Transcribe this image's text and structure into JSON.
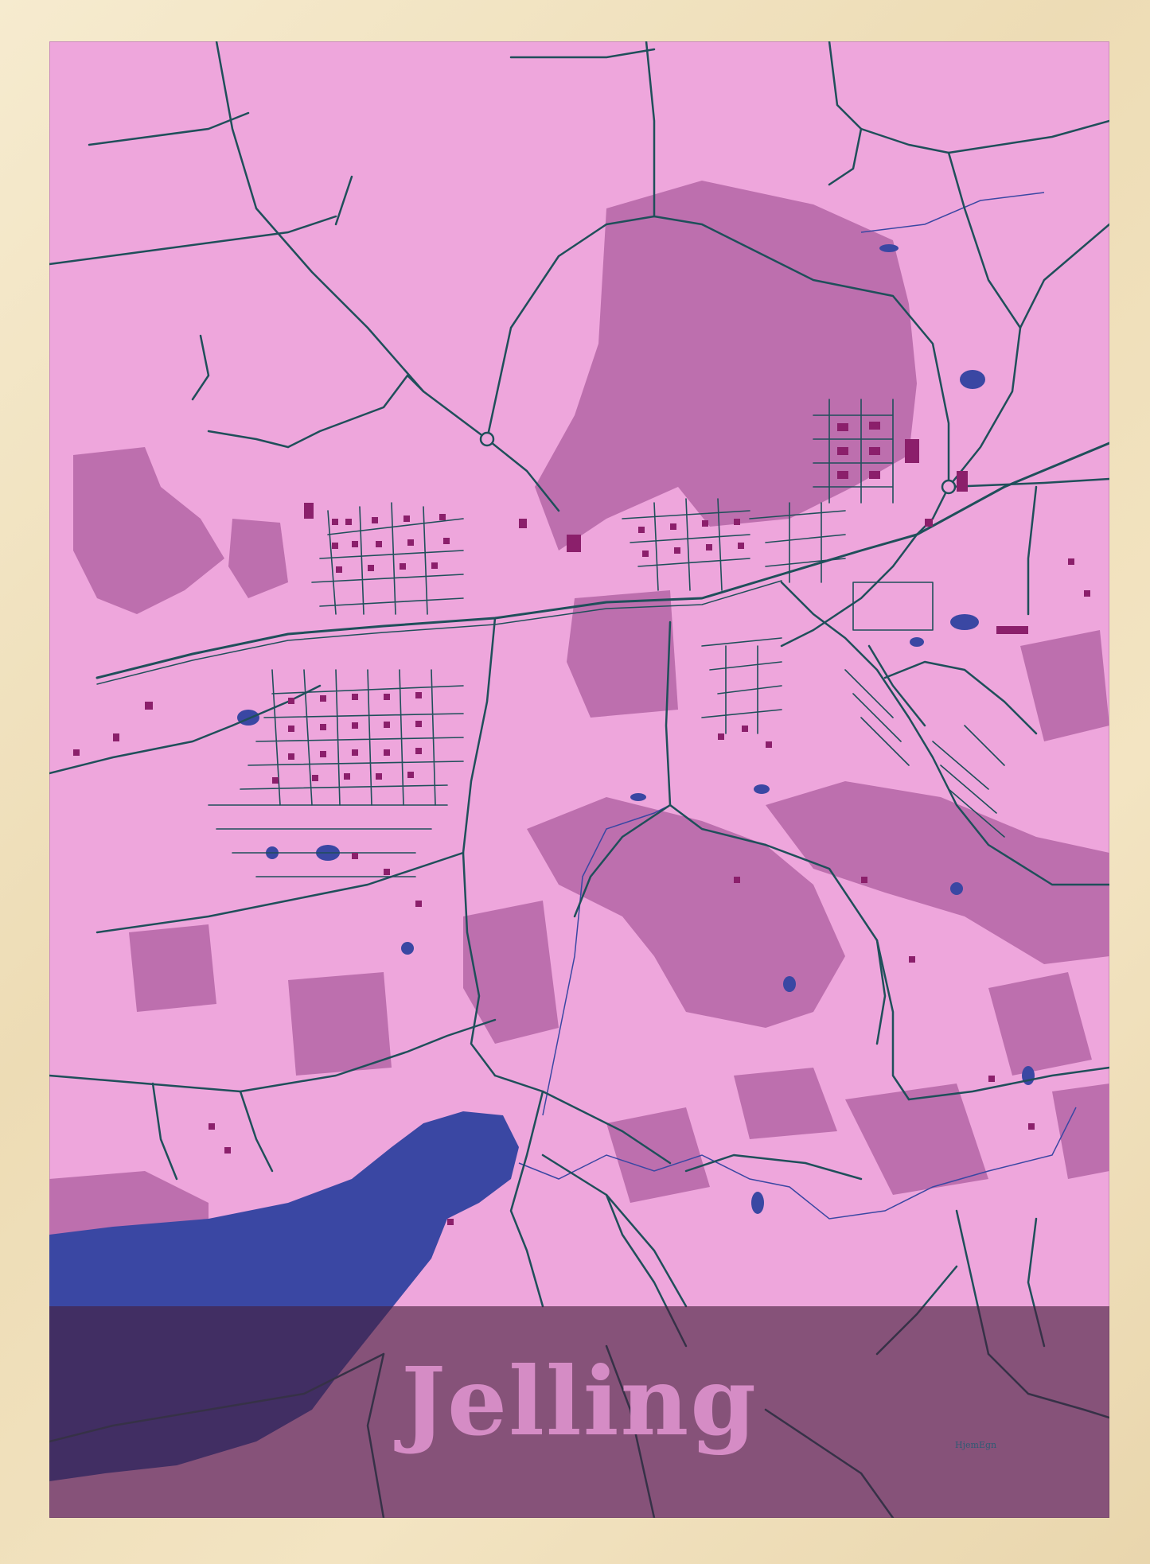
{
  "poster": {
    "title": "Jelling",
    "brand": "HjemEgn"
  },
  "colors": {
    "background": "#eea6dc",
    "areas": "#bd6fae",
    "roads": "#1f4f5a",
    "buildings": "#8b1f6b",
    "water": "#3a47a3",
    "band": "#461e3c",
    "title": "#d58cc5",
    "frame": "#f0e0bd"
  }
}
